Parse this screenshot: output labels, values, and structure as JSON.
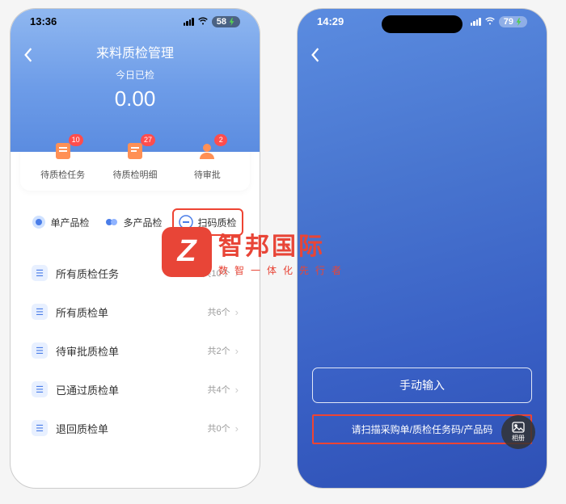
{
  "left": {
    "status": {
      "time": "13:36",
      "battery": "58"
    },
    "header": {
      "title": "来料质检管理",
      "subtitle": "今日已检",
      "value": "0.00"
    },
    "top_cards": [
      {
        "label": "待质检任务",
        "badge": "10"
      },
      {
        "label": "待质检明细",
        "badge": "27"
      },
      {
        "label": "待审批",
        "badge": "2"
      }
    ],
    "tabs": [
      {
        "label": "单产品检"
      },
      {
        "label": "多产品检"
      },
      {
        "label": "扫码质检"
      }
    ],
    "list": [
      {
        "label": "所有质检任务",
        "count": "共10个"
      },
      {
        "label": "所有质检单",
        "count": "共6个"
      },
      {
        "label": "待审批质检单",
        "count": "共2个"
      },
      {
        "label": "已通过质检单",
        "count": "共4个"
      },
      {
        "label": "退回质检单",
        "count": "共0个"
      }
    ]
  },
  "right": {
    "status": {
      "time": "14:29",
      "battery": "79"
    },
    "manual_label": "手动输入",
    "hint": "请扫描采购单/质检任务码/产品码",
    "album_label": "相册"
  },
  "watermark": {
    "logo": "Z",
    "title": "智邦国际",
    "subtitle": "数智一体化先行者"
  }
}
